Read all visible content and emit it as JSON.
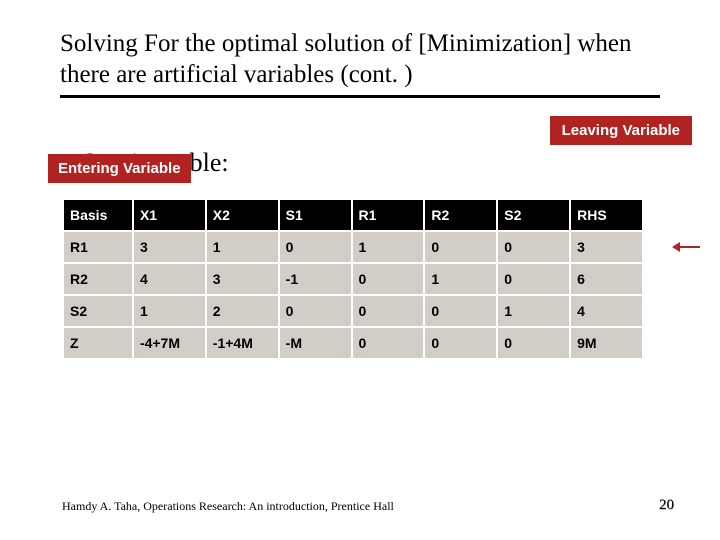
{
  "title": "Solving For the optimal solution of [Minimization] when there are artificial variables (cont. )",
  "leaving_label": "Leaving Variable",
  "entering_label": "Entering Variable",
  "bullet_text": "Starting table:",
  "chart_data": {
    "type": "table",
    "headers": [
      "Basis",
      "X1",
      "X2",
      "S1",
      "R1",
      "R2",
      "S2",
      "RHS"
    ],
    "rows": [
      [
        "R1",
        "3",
        "1",
        "0",
        "1",
        "0",
        "0",
        "3"
      ],
      [
        "R2",
        "4",
        "3",
        "-1",
        "0",
        "1",
        "0",
        "6"
      ],
      [
        "S2",
        "1",
        "2",
        "0",
        "0",
        "0",
        "1",
        "4"
      ],
      [
        "Z",
        "-4+7M",
        "-1+4M",
        "-M",
        "0",
        "0",
        "0",
        "9M"
      ]
    ]
  },
  "footer": "Hamdy A. Taha, Operations Research: An introduction, Prentice Hall",
  "page_number": "20"
}
